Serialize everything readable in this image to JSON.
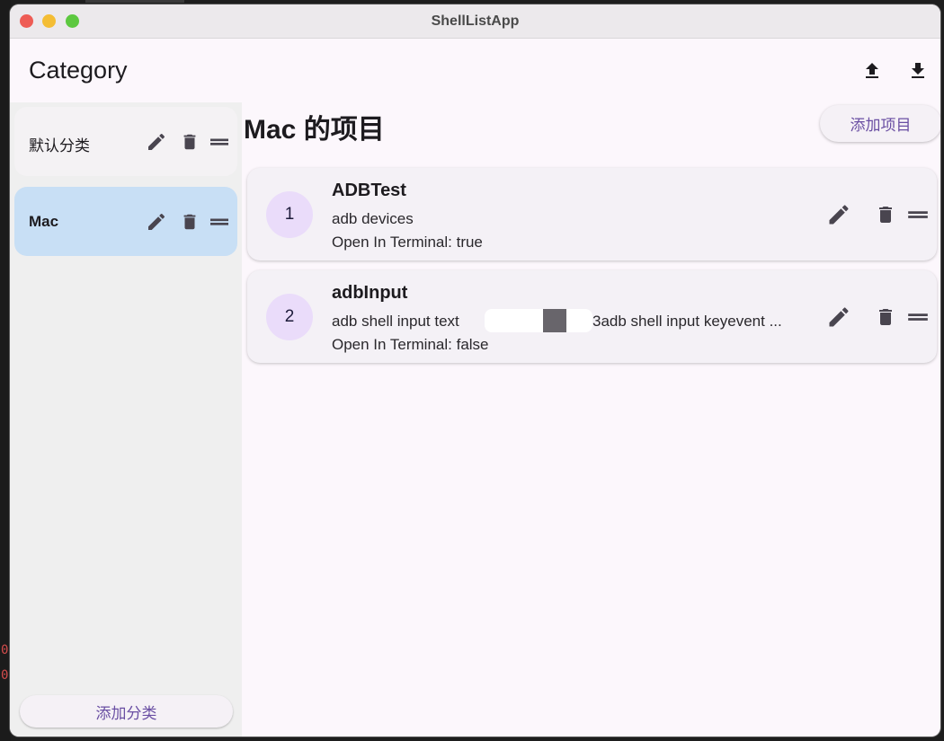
{
  "window": {
    "title": "ShellListApp"
  },
  "appbar": {
    "title": "Category",
    "upload_icon": "upload-icon",
    "download_icon": "download-icon"
  },
  "sidebar": {
    "categories": [
      {
        "label": "默认分类",
        "active": false
      },
      {
        "label": "Mac",
        "active": true
      }
    ],
    "add_label": "添加分类"
  },
  "main": {
    "title": "Mac 的项目",
    "add_item_label": "添加项目",
    "items": [
      {
        "index": "1",
        "title": "ADBTest",
        "command": "adb devices",
        "terminal": "Open In Terminal: true"
      },
      {
        "index": "2",
        "title": "adbInput",
        "command_start": "adb shell input text",
        "command_end": "3adb shell input keyevent ...",
        "terminal": "Open In Terminal: false"
      }
    ]
  },
  "colors": {
    "accent": "#6a4fa3",
    "selected_category": "#c8dff5",
    "avatar_bg": "#eadcfa",
    "icon": "#49454f"
  }
}
